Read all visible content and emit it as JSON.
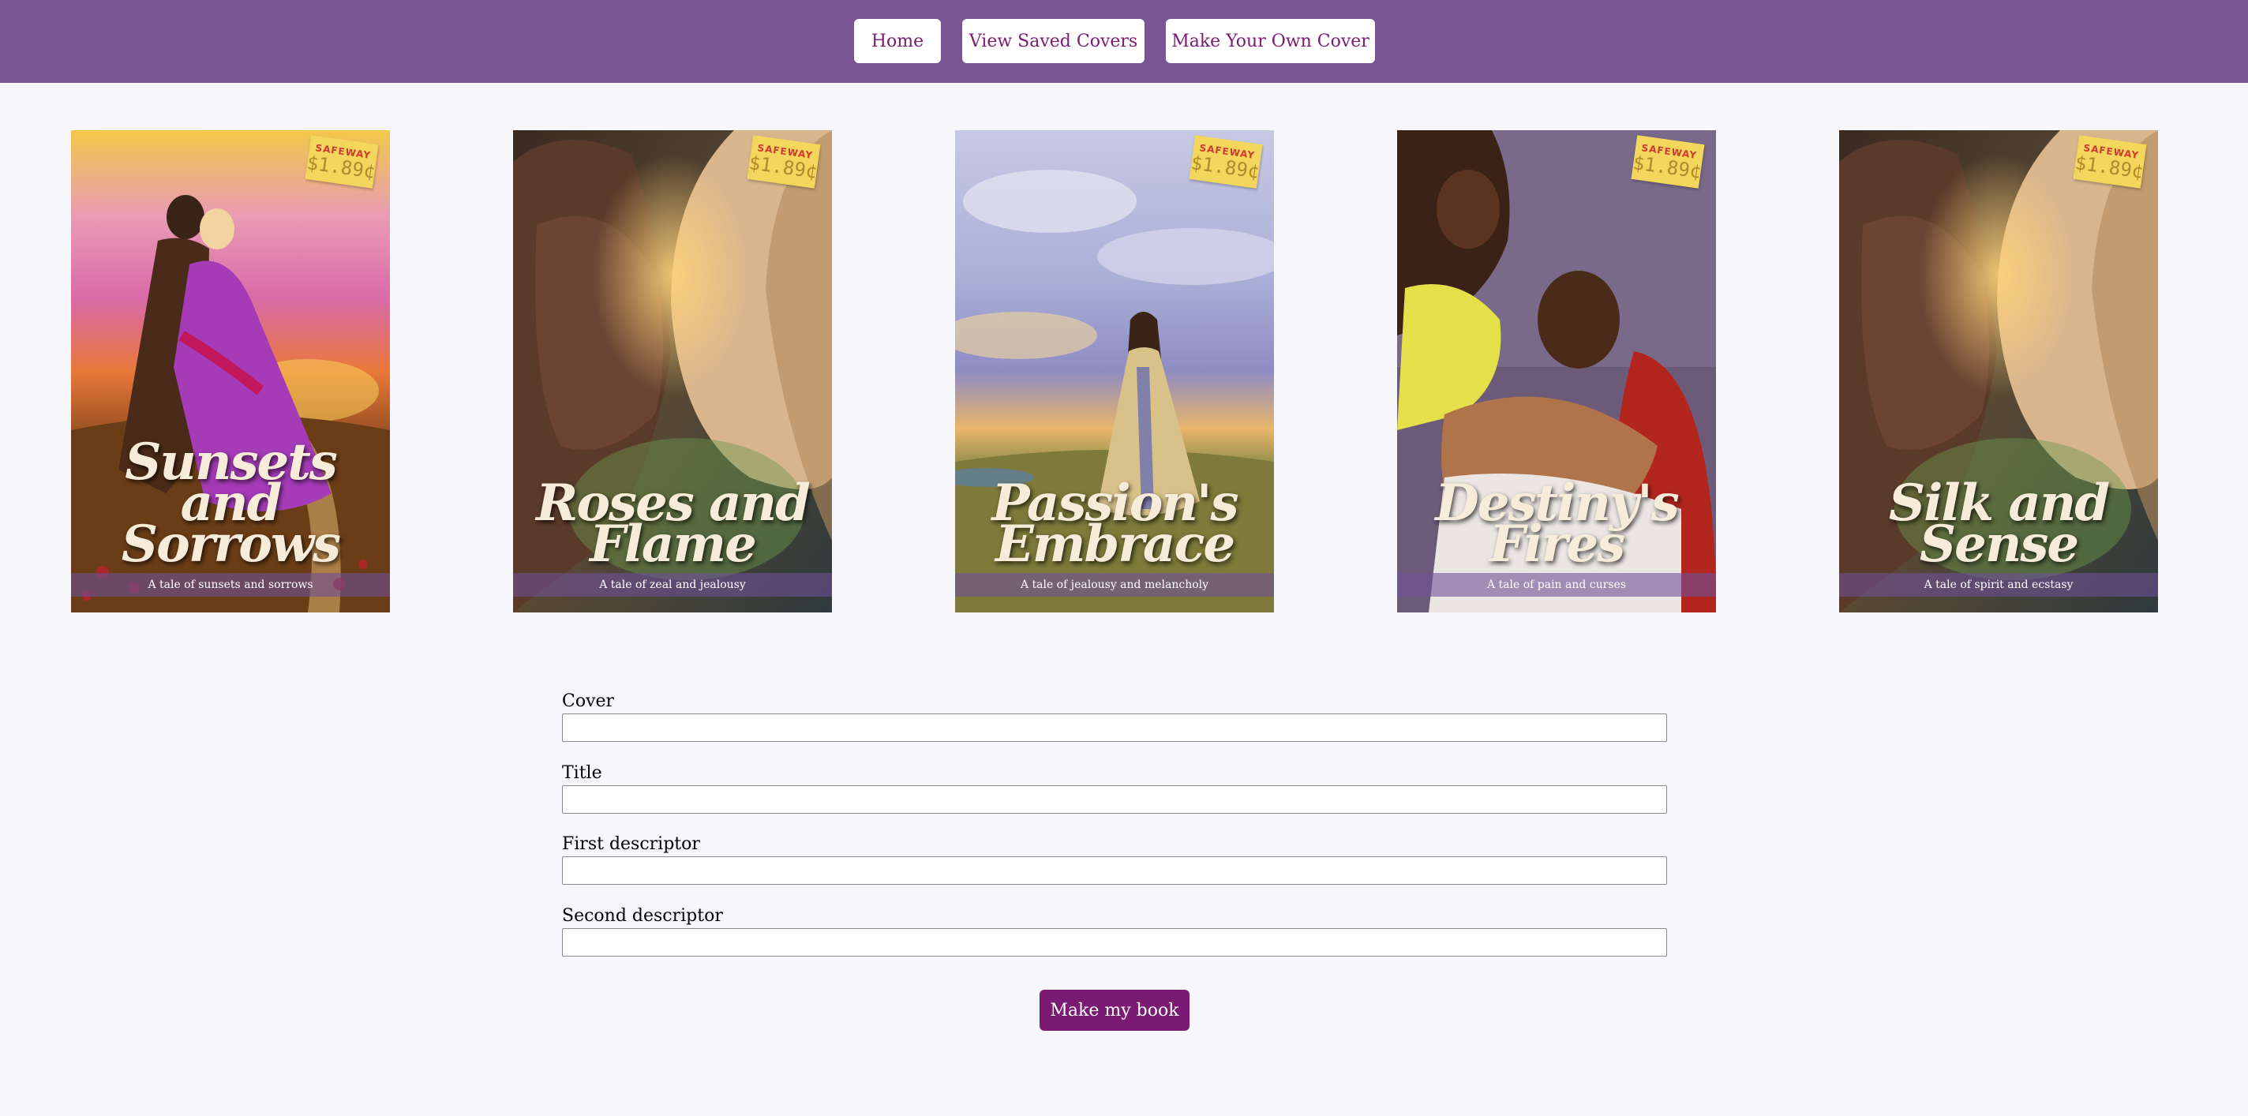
{
  "nav": {
    "home": "Home",
    "saved": "View Saved Covers",
    "make": "Make Your Own Cover"
  },
  "colors": {
    "nav_background": "#7a5594",
    "button_text": "#7b1a73",
    "primary_button": "#7b1a73",
    "page_background": "#f7f6fb"
  },
  "covers": [
    {
      "title": "Sunsets and Sorrows",
      "tagline": "A tale of sunsets and sorrows",
      "price_brand": "SAFEWAY",
      "price": "$1.89¢",
      "scene": "embracing couple in a field at sunset"
    },
    {
      "title": "Roses and Flame",
      "tagline": "A tale of zeal and jealousy",
      "price_brand": "SAFEWAY",
      "price": "$1.89¢",
      "scene": "two faces about to kiss"
    },
    {
      "title": "Passion's Embrace",
      "tagline": "A tale of jealousy and melancholy",
      "price_brand": "SAFEWAY",
      "price": "$1.89¢",
      "scene": "woman in a gown on a windy cliff"
    },
    {
      "title": "Destiny's Fires",
      "tagline": "A tale of pain and curses",
      "price_brand": "SAFEWAY",
      "price": "$1.89¢",
      "scene": "woman leaning over a reclining man"
    },
    {
      "title": "Silk and Sense",
      "tagline": "A tale of spirit and ecstasy",
      "price_brand": "SAFEWAY",
      "price": "$1.89¢",
      "scene": "two faces about to kiss"
    }
  ],
  "form": {
    "cover_label": "Cover",
    "cover_value": "",
    "title_label": "Title",
    "title_value": "",
    "desc1_label": "First descriptor",
    "desc1_value": "",
    "desc2_label": "Second descriptor",
    "desc2_value": "",
    "submit_label": "Make my book"
  }
}
